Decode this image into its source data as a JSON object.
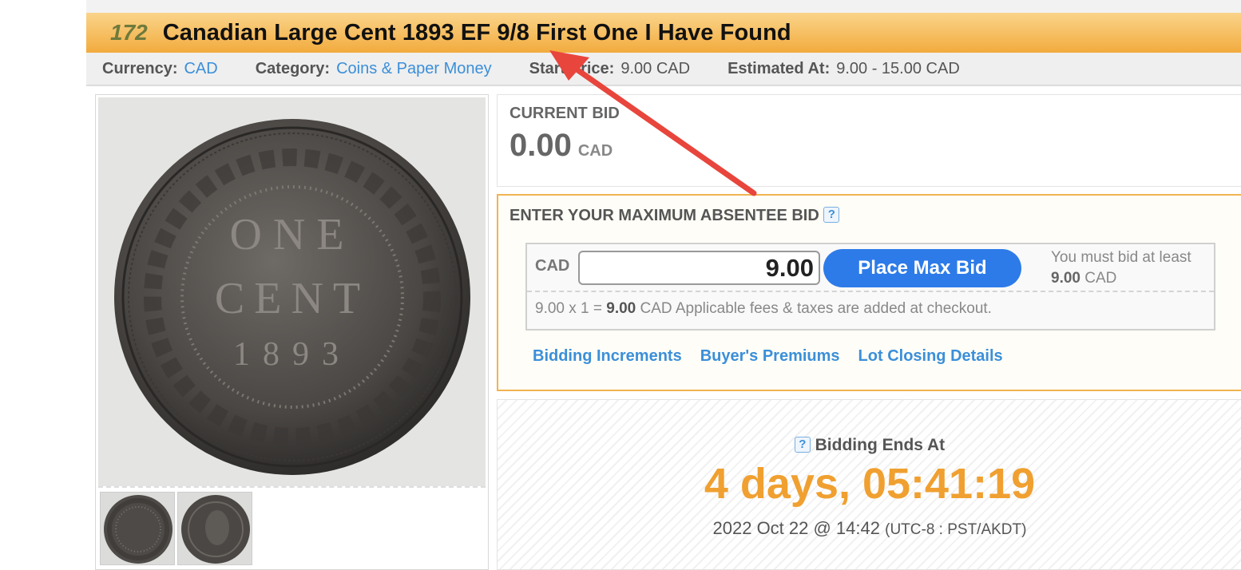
{
  "lot": {
    "number": "172",
    "title": "Canadian Large Cent 1893 EF 9/8 First One I Have Found"
  },
  "meta": {
    "currency_label": "Currency:",
    "currency_value": "CAD",
    "category_label": "Category:",
    "category_value": "Coins & Paper Money",
    "start_price_label": "Start Price:",
    "start_price_value": "9.00 CAD",
    "estimated_label": "Estimated At:",
    "estimated_value": "9.00 - 15.00 CAD"
  },
  "current_bid": {
    "label": "CURRENT BID",
    "amount": "0.00",
    "currency": "CAD"
  },
  "absentee": {
    "heading": "ENTER YOUR MAXIMUM ABSENTEE BID",
    "help_icon": "?",
    "currency": "CAD",
    "input_value": "9.00",
    "button_label": "Place Max Bid",
    "min_note_prefix": "You must bid at least",
    "min_amount": "9.00",
    "min_currency": "CAD",
    "calc_prefix": "9.00 x 1 =",
    "calc_total": "9.00",
    "calc_suffix": "CAD  Applicable fees & taxes are added at checkout."
  },
  "links": {
    "increments": "Bidding Increments",
    "premiums": "Buyer's Premiums",
    "closing": "Lot Closing Details"
  },
  "ends": {
    "help_icon": "?",
    "label": "Bidding Ends At",
    "countdown": "4 days, 05:41:19",
    "date": "2022 Oct 22 @ 14:42",
    "timezone": "(UTC-8 : PST/AKDT)"
  },
  "coin": {
    "line1": "ONE",
    "line2": "CENT",
    "line3": "1893"
  },
  "colors": {
    "accent_orange": "#f0a030",
    "link_blue": "#3b8fd9",
    "button_blue": "#2d7be8",
    "annotation_red": "#e8453c"
  }
}
